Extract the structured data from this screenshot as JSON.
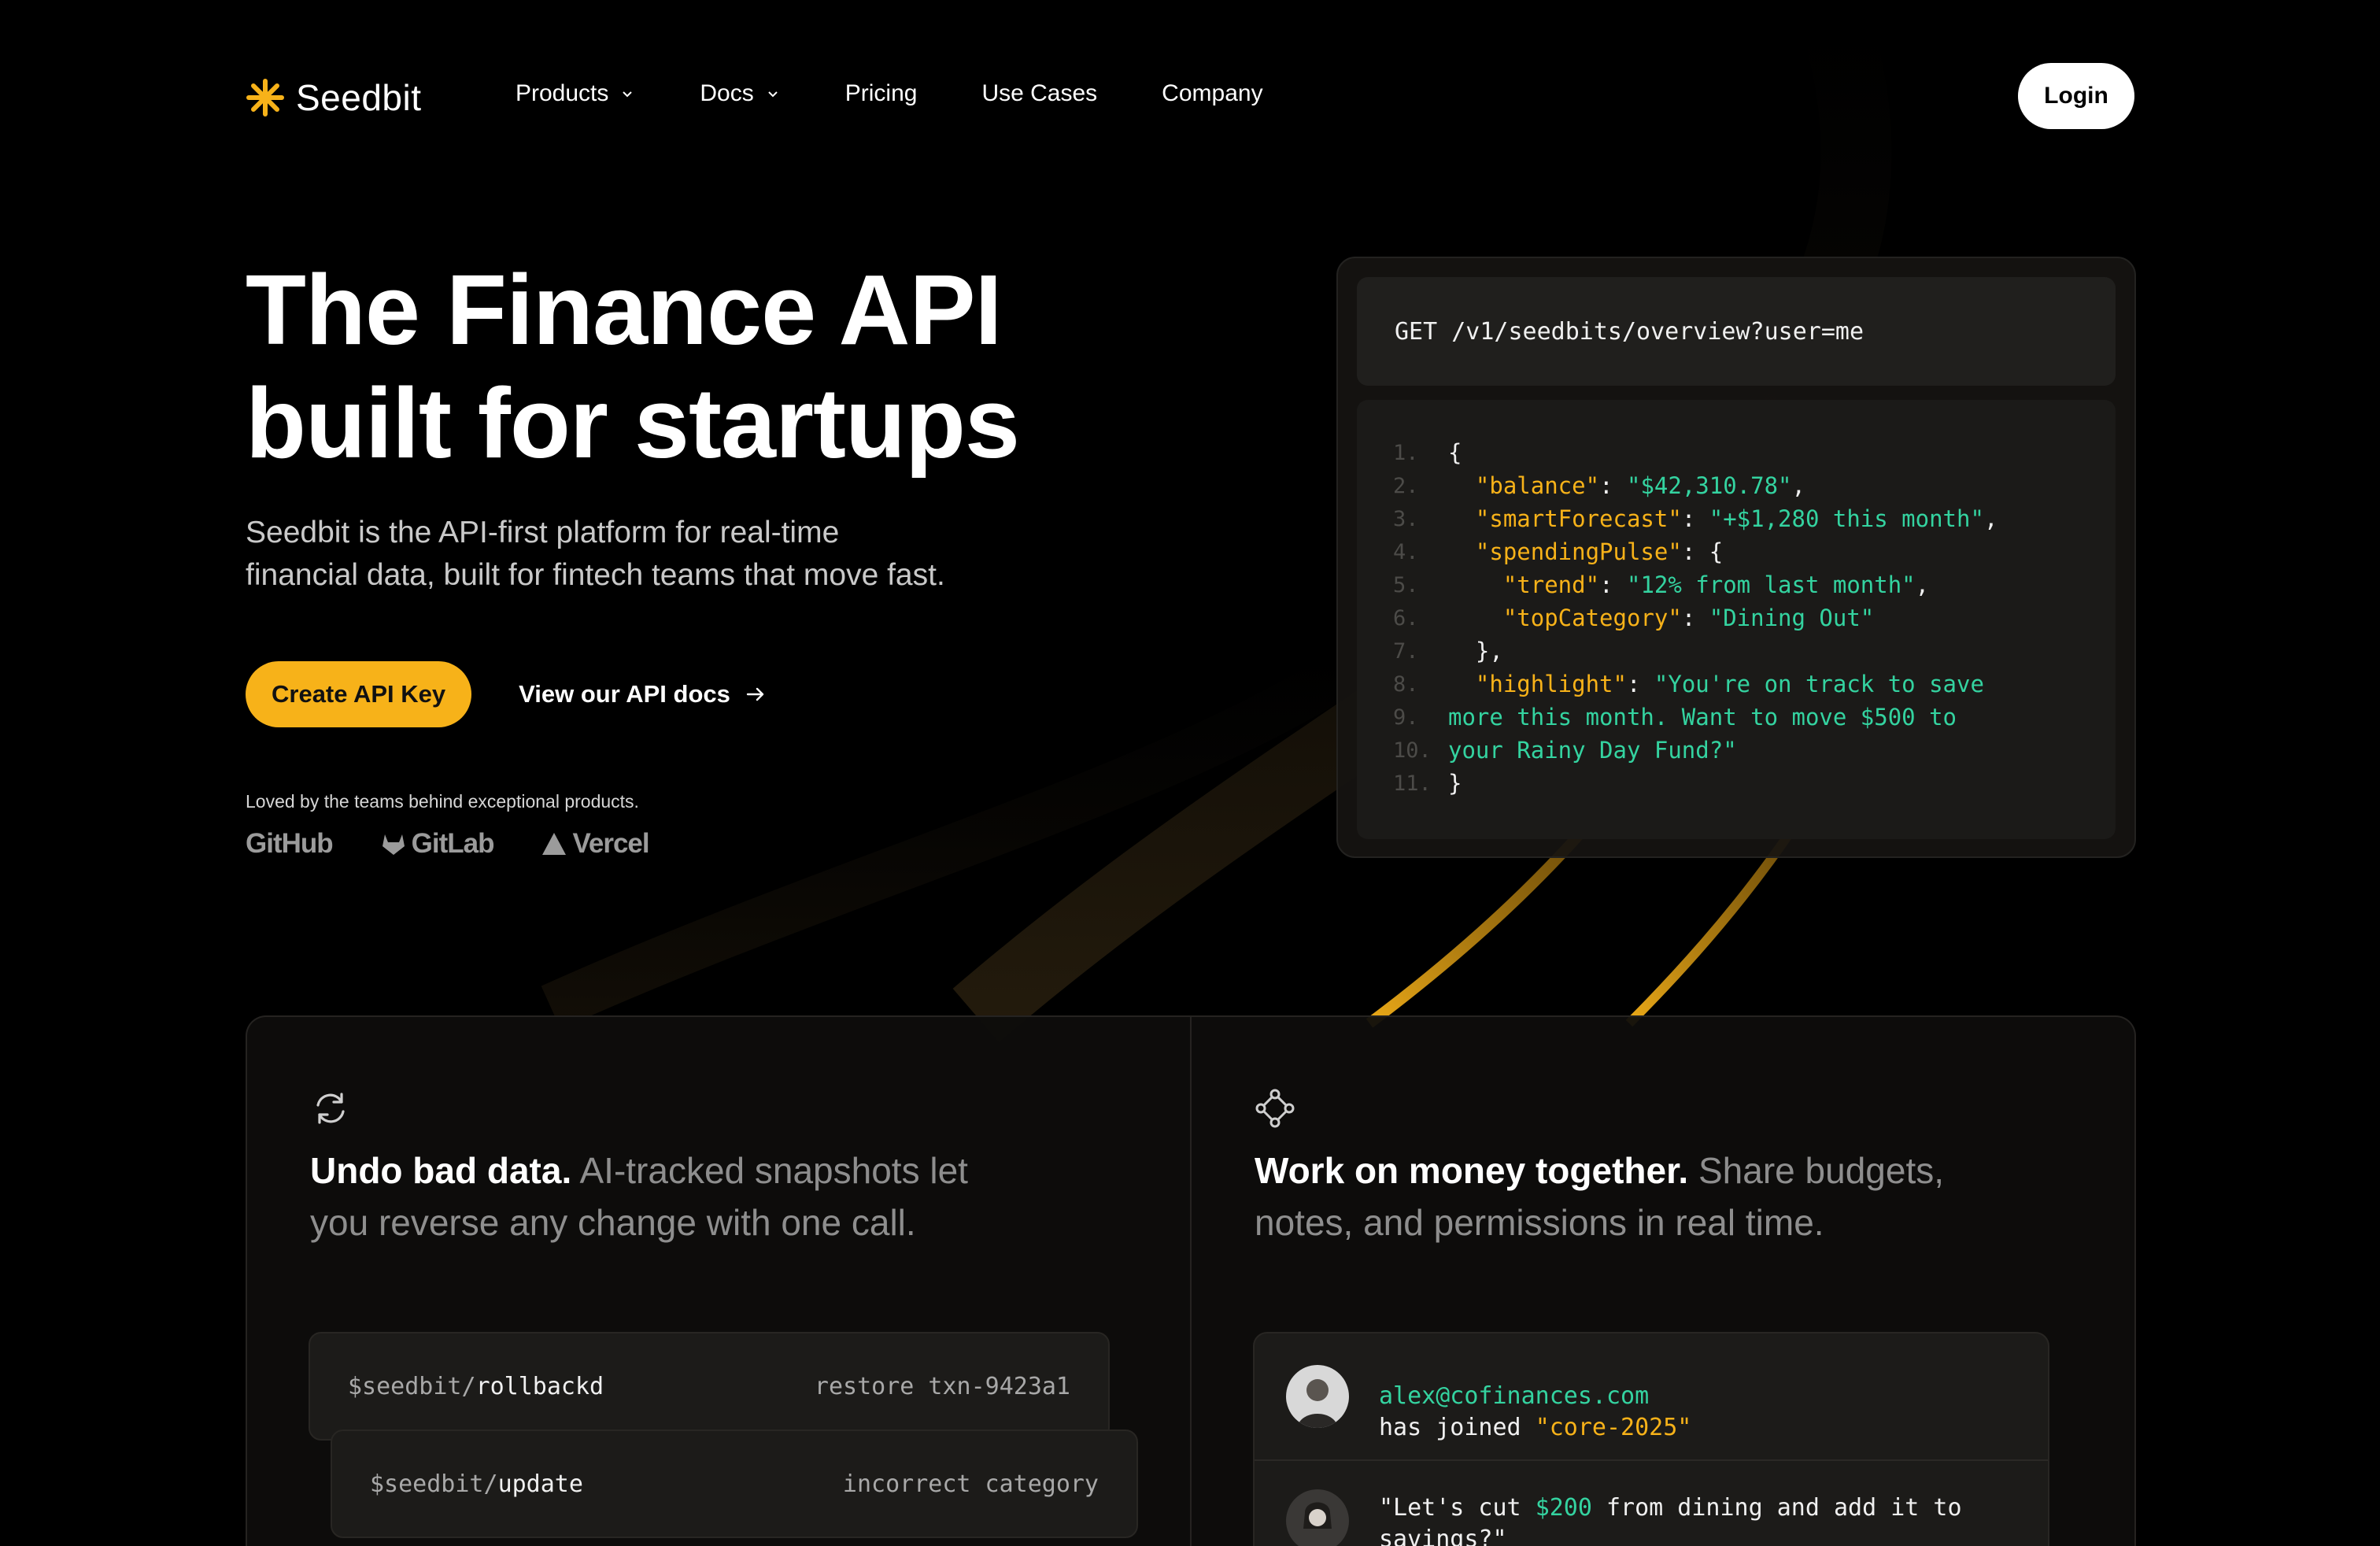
{
  "brand": {
    "name": "Seedbit",
    "accent": "#f7b219",
    "icon": "asterisk-logo-icon"
  },
  "nav": {
    "items": [
      {
        "label": "Products",
        "has_dropdown": true
      },
      {
        "label": "Docs",
        "has_dropdown": true
      },
      {
        "label": "Pricing",
        "has_dropdown": false
      },
      {
        "label": "Use Cases",
        "has_dropdown": false
      },
      {
        "label": "Company",
        "has_dropdown": false
      }
    ],
    "login_label": "Login"
  },
  "hero": {
    "title_line1": "The Finance API",
    "title_line2": "built for startups",
    "subtitle_line1": "Seedbit is the API-first platform for real-time",
    "subtitle_line2": "financial data, built for fintech teams that move fast.",
    "cta_primary": "Create API Key",
    "cta_secondary": "View our API docs",
    "loved_by": "Loved by the teams behind exceptional products.",
    "brands": [
      "GitHub",
      "GitLab",
      "Vercel"
    ]
  },
  "code": {
    "request": "GET /v1/seedbits/overview?user=me",
    "lines": {
      "n1": "1.",
      "n2": "2.",
      "n3": "3.",
      "n4": "4.",
      "n5": "5.",
      "n6": "6.",
      "n7": "7.",
      "n8": "8.",
      "n9": "9.",
      "n10": "10.",
      "n11": "11.",
      "open": "{",
      "balance_key": "\"balance\"",
      "balance_val": "\"$42,310.78\"",
      "forecast_key": "\"smartForecast\"",
      "forecast_val": "\"+$1,280 this month\"",
      "pulse_key": "\"spendingPulse\"",
      "trend_key": "\"trend\"",
      "trend_val": "\"12% from last month\"",
      "category_key": "\"topCategory\"",
      "category_val": "\"Dining Out\"",
      "close_inner": "},",
      "highlight_key": "\"highlight\"",
      "highlight_val1": "\"You're on track to save",
      "highlight_val2": "more this month. Want to move $500 to",
      "highlight_val3": "your Rainy Day Fund?\"",
      "close": "}"
    }
  },
  "features": {
    "undo": {
      "icon": "refresh-cycle-icon",
      "title": "Undo bad data.",
      "desc_line1": "AI-tracked snapshots let",
      "desc_line2": "you reverse any change with one call.",
      "cli": [
        {
          "prefix": "$seedbit/",
          "cmd": "rollbackd",
          "note": "restore txn-9423a1"
        },
        {
          "prefix": "$seedbit/",
          "cmd": "update",
          "note": "incorrect category"
        }
      ]
    },
    "collab": {
      "icon": "network-nodes-icon",
      "title": "Work on money together.",
      "desc_line1": "Share budgets,",
      "desc_line2": "notes, and permissions in real time.",
      "messages": {
        "join_email": "alex@cofinances.com",
        "join_text": "has joined",
        "join_team": "\"core-2025\"",
        "quote_start": "\"Let's cut",
        "quote_amount": "$200",
        "quote_mid": "from dining and add it to",
        "quote_end": "savings?\""
      }
    }
  }
}
